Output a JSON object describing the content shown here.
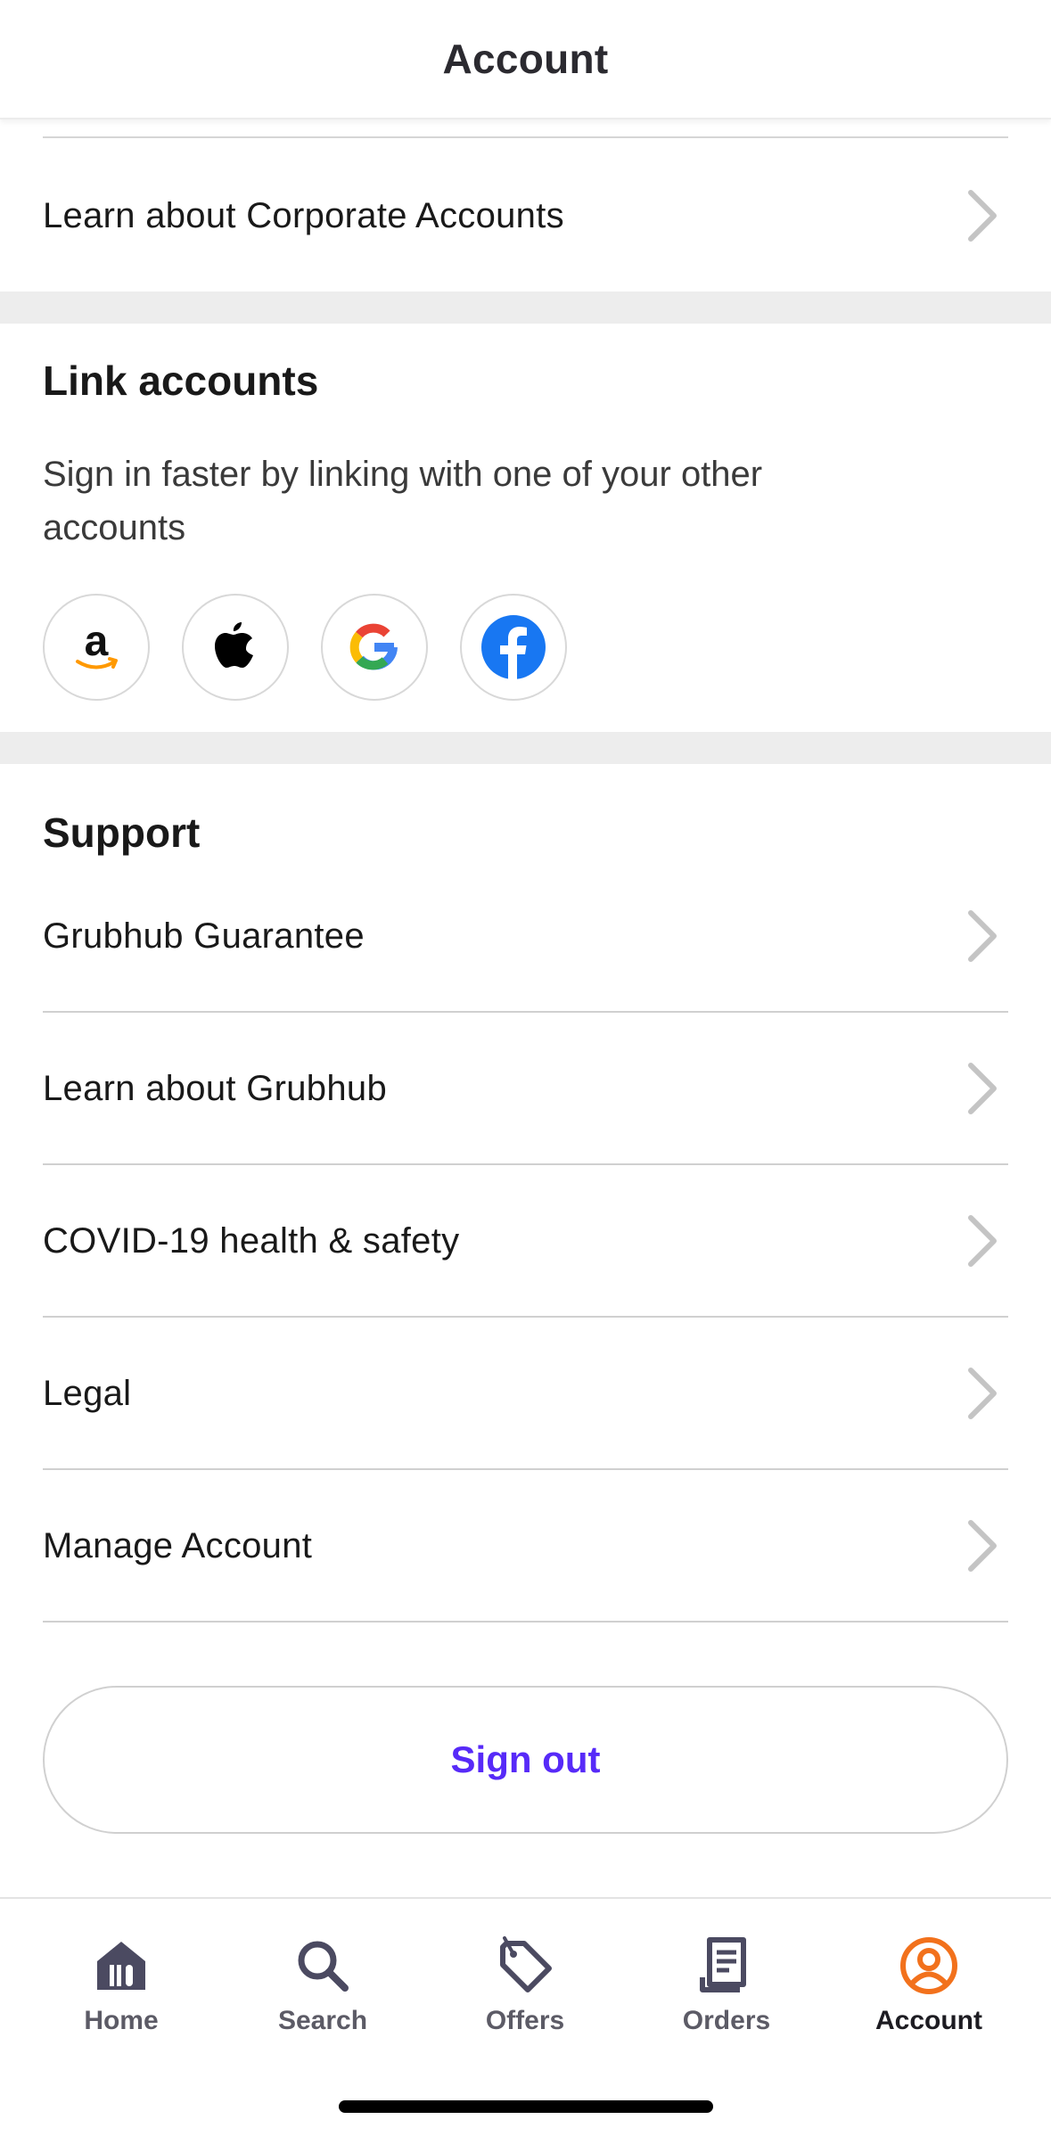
{
  "header": {
    "title": "Account"
  },
  "corporate": {
    "label": "Learn about Corporate Accounts"
  },
  "link_accounts": {
    "title": "Link accounts",
    "description": "Sign in faster by linking with one of your other accounts",
    "providers": [
      "amazon-icon",
      "apple-icon",
      "google-icon",
      "facebook-icon"
    ]
  },
  "support": {
    "title": "Support",
    "items": [
      {
        "label": "Grubhub Guarantee"
      },
      {
        "label": "Learn about Grubhub"
      },
      {
        "label": "COVID-19 health & safety"
      },
      {
        "label": "Legal"
      },
      {
        "label": "Manage Account"
      }
    ]
  },
  "sign_out": {
    "label": "Sign out"
  },
  "tabbar": {
    "active": "Account",
    "tabs": [
      {
        "label": "Home",
        "icon": "home-icon"
      },
      {
        "label": "Search",
        "icon": "search-icon"
      },
      {
        "label": "Offers",
        "icon": "offers-tag-icon"
      },
      {
        "label": "Orders",
        "icon": "orders-receipt-icon"
      },
      {
        "label": "Account",
        "icon": "account-person-icon"
      }
    ]
  },
  "colors": {
    "accent": "#572af8",
    "active_tab": "#f2711c",
    "tab_icon": "#4b4a61",
    "divider_band": "#ededed"
  }
}
